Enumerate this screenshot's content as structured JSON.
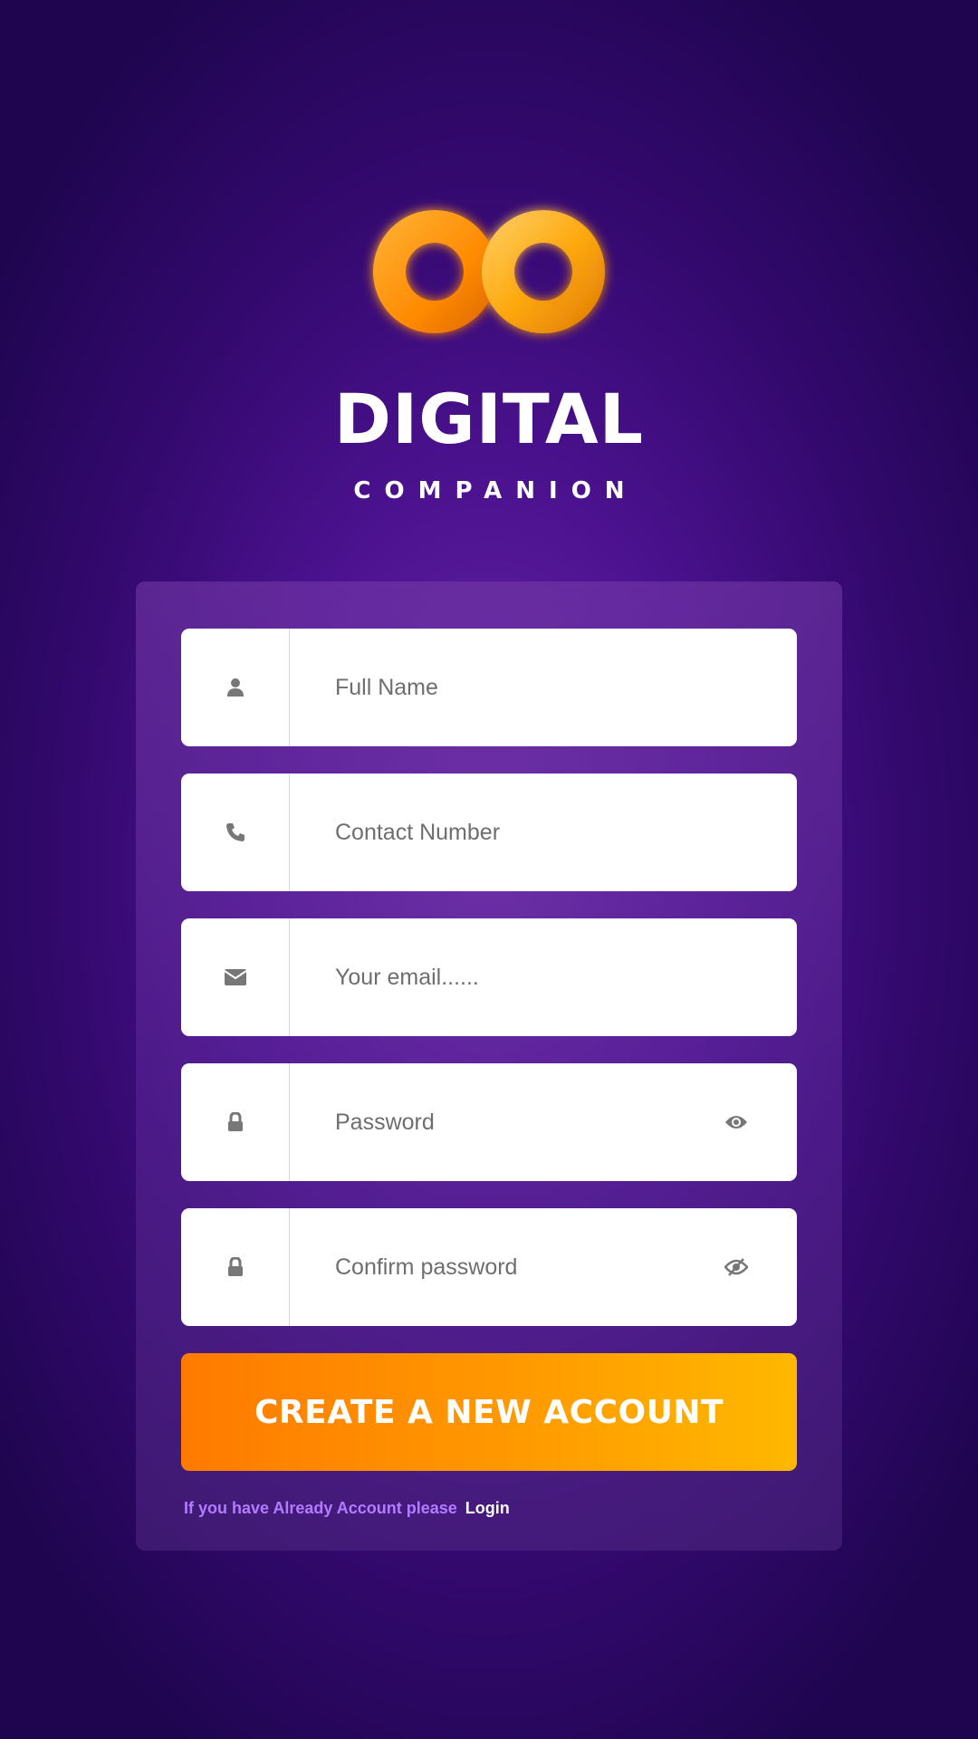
{
  "brand": {
    "title": "DIGITAL",
    "subtitle": "COMPANION",
    "logo_icon": "infinity-icon"
  },
  "form": {
    "fields": [
      {
        "icon": "user-icon",
        "placeholder": "Full Name",
        "value": ""
      },
      {
        "icon": "phone-icon",
        "placeholder": "Contact Number",
        "value": ""
      },
      {
        "icon": "envelope-icon",
        "placeholder": "Your email......",
        "value": ""
      },
      {
        "icon": "lock-icon",
        "placeholder": "Password",
        "value": "",
        "toggle_icon": "eye-icon"
      },
      {
        "icon": "lock-icon",
        "placeholder": "Confirm password",
        "value": "",
        "toggle_icon": "eye-slash-icon"
      }
    ],
    "submit_label": "CREATE A NEW ACCOUNT",
    "footer_text": "If you have Already Account please",
    "login_link": "Login"
  },
  "colors": {
    "accent_start": "#ff7a00",
    "accent_end": "#ffb800",
    "background": "#4c1290",
    "footer_text": "#b37bff"
  }
}
